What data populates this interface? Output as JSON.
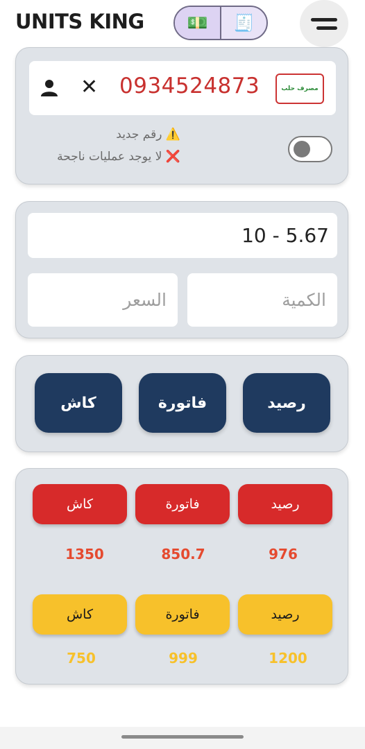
{
  "header": {
    "title": "UNITS KING",
    "toggle_left_icon": "💵",
    "toggle_right_icon": "🧾"
  },
  "customer": {
    "phone": "0934524873",
    "close_glyph": "✕",
    "logo_text": "مصرف حلب",
    "status_new": "⚠️ رقم جديد",
    "status_none": "❌ لا يوجد عمليات ناجحة"
  },
  "entry": {
    "amount_value": "10 - 5.67",
    "quantity_placeholder": "الكمية",
    "price_placeholder": "السعر"
  },
  "actions": {
    "balance_label": "رصيد",
    "invoice_label": "فاتورة",
    "cash_label": "كاش"
  },
  "stats": {
    "red": [
      {
        "label": "رصيد",
        "value": "976"
      },
      {
        "label": "فاتورة",
        "value": "850.7"
      },
      {
        "label": "كاش",
        "value": "1350"
      }
    ],
    "yellow": [
      {
        "label": "رصيد",
        "value": "1200"
      },
      {
        "label": "فاتورة",
        "value": "999"
      },
      {
        "label": "كاش",
        "value": "750"
      }
    ]
  },
  "colors": {
    "navy": "#1f3a5f",
    "red": "#d72a2a",
    "yellow": "#f7c12b",
    "phone_red": "#c8312f"
  }
}
